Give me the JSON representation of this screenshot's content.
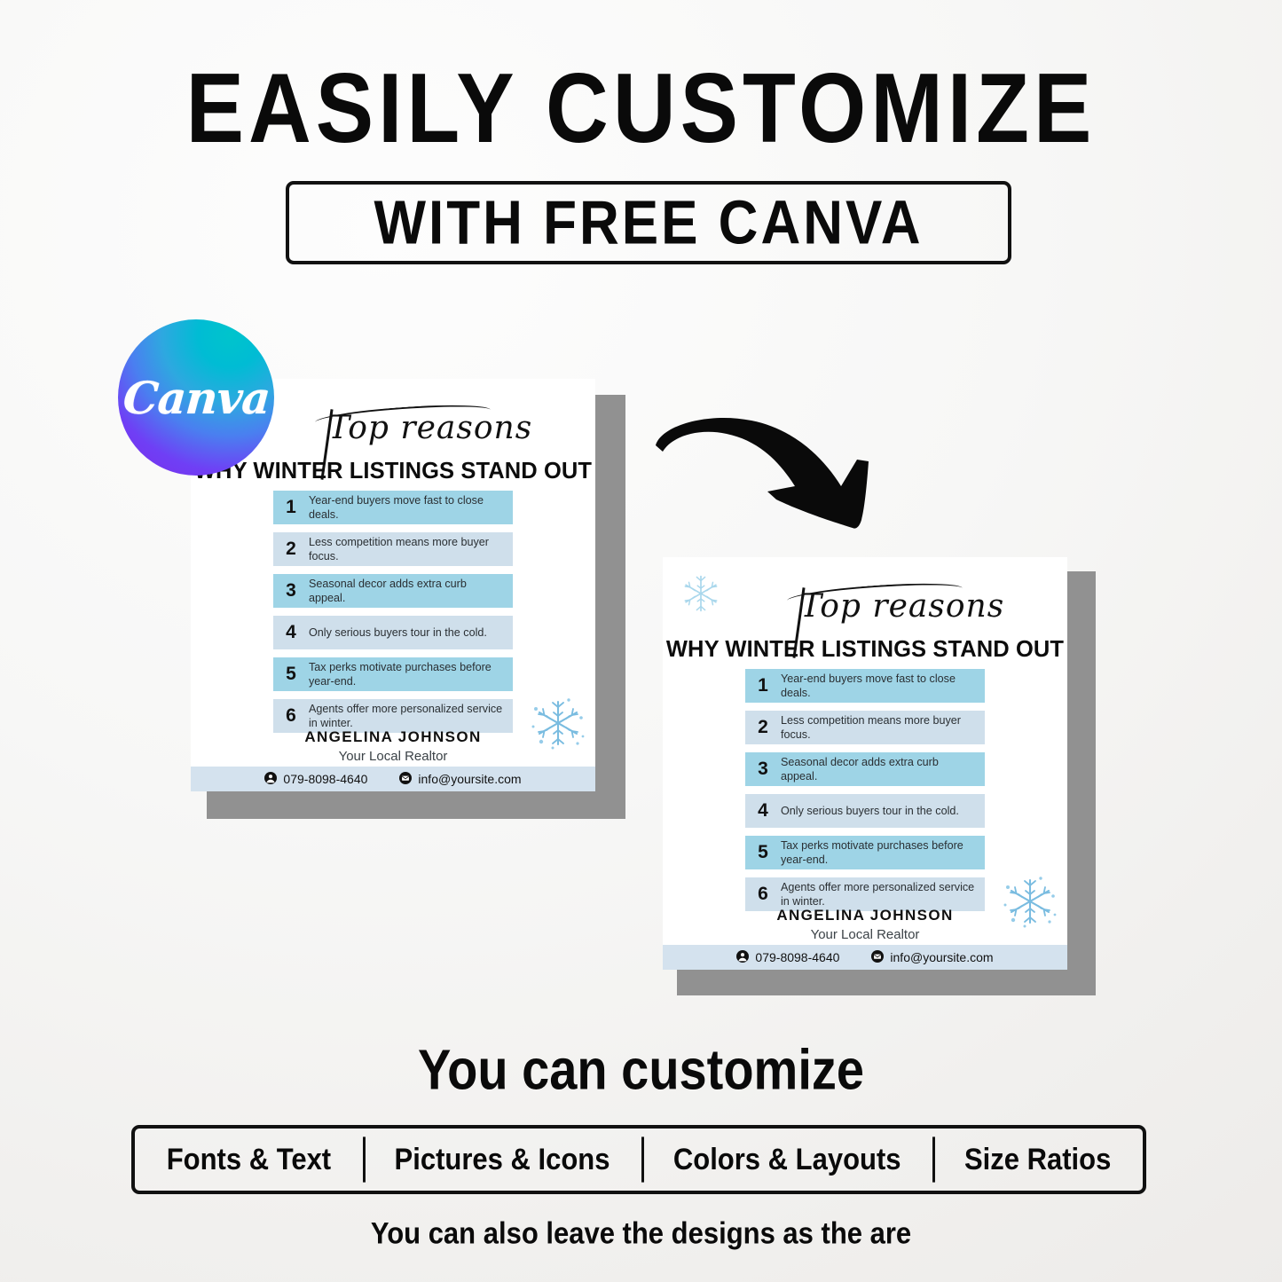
{
  "header": {
    "headline": "EASILY CUSTOMIZE",
    "subhead_box": "WITH FREE CANVA"
  },
  "canva_badge": {
    "label": "Canva",
    "gradient_from": "#00c4cc",
    "gradient_to": "#7d2ae8"
  },
  "arrow": {
    "name": "curved-arrow-right-down",
    "color": "#0a0a0a"
  },
  "flyer": {
    "script_title": "Top reasons",
    "main_title": "WHY WINTER LISTINGS STAND OUT",
    "rows": [
      {
        "num": "1",
        "text": "Year-end buyers move fast to close deals.",
        "bg": "#9ed4e6"
      },
      {
        "num": "2",
        "text": "Less competition means more buyer focus.",
        "bg": "#cfdfeb"
      },
      {
        "num": "3",
        "text": "Seasonal decor adds extra curb appeal.",
        "bg": "#9ed4e6"
      },
      {
        "num": "4",
        "text": "Only serious buyers tour in the cold.",
        "bg": "#cfdfeb"
      },
      {
        "num": "5",
        "text": "Tax perks motivate purchases before year-end.",
        "bg": "#9ed4e6"
      },
      {
        "num": "6",
        "text": "Agents offer more personalized service in winter.",
        "bg": "#cfdfeb"
      }
    ],
    "signature_name": "ANGELINA  JOHNSON",
    "signature_role": "Your Local Realtor",
    "phone": "079-8098-4640",
    "email": "info@yoursite.com",
    "phone_icon": "person-circle-icon",
    "email_icon": "envelope-circle-icon",
    "footer_bg": "#d4e2ee",
    "shadow_color": "#919191",
    "snowflake_color": "#6fb7de"
  },
  "bottom": {
    "title": "You can customize",
    "options": [
      "Fonts & Text",
      "Pictures & Icons",
      "Colors & Layouts",
      "Size Ratios"
    ],
    "footnote": "You can also leave the designs as the are"
  }
}
